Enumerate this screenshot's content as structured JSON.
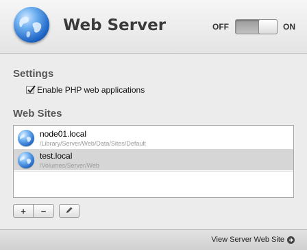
{
  "header": {
    "title": "Web Server",
    "toggle": {
      "off_label": "OFF",
      "on_label": "ON",
      "state": "on"
    },
    "icon": "globe-icon"
  },
  "settings": {
    "title": "Settings",
    "php_checkbox": {
      "label": "Enable PHP web applications",
      "checked": true
    }
  },
  "web_sites": {
    "title": "Web Sites",
    "items": [
      {
        "name": "node01.local",
        "path": "/Library/Server/Web/Data/Sites/Default",
        "selected": false
      },
      {
        "name": "test.local",
        "path": "/Volumes/Server/Web",
        "selected": true
      }
    ]
  },
  "actions": {
    "add_label": "+",
    "remove_label": "−",
    "edit_icon": "pencil-icon"
  },
  "footer": {
    "link_label": "View Server Web Site",
    "link_icon": "arrow-circle-icon"
  }
}
